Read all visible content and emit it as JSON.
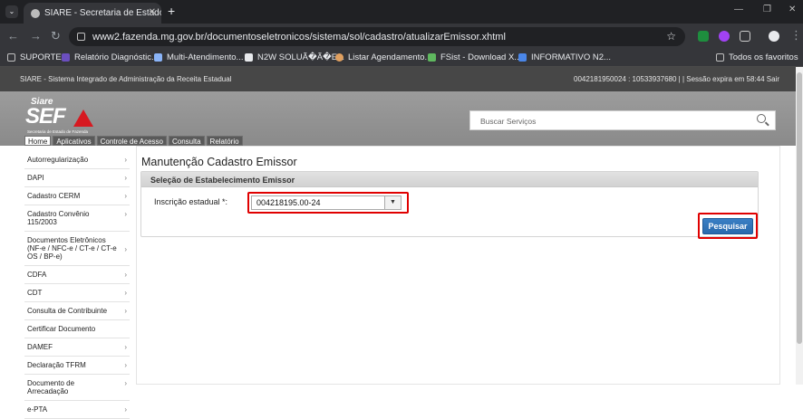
{
  "browser": {
    "tab_title": "SIARE - Secretaria de Estado de...",
    "url": "www2.fazenda.mg.gov.br/documentoseletronicos/sistema/sol/cadastro/atualizarEmissor.xhtml",
    "bookmarks": [
      {
        "label": "SUPORTE",
        "color": "#c0c0c0"
      },
      {
        "label": "Relatório Diagnóstic...",
        "color": "#6b4fbf"
      },
      {
        "label": "Multi-Atendimento...",
        "color": "#8ab4f8"
      },
      {
        "label": "N2W SOLUÃ�Ã�E...",
        "color": "#e8eaed"
      },
      {
        "label": "Listar Agendamento...",
        "color": "#e0a060"
      },
      {
        "label": "FSist - Download X...",
        "color": "#5fb85f"
      },
      {
        "label": "INFORMATIVO N2...",
        "color": "#4a86e8"
      }
    ],
    "all_bookmarks": "Todos os favoritos",
    "icons": [
      "tab-menu-icon",
      "back-icon",
      "forward-icon",
      "reload-icon",
      "site-info-icon",
      "star-icon",
      "extension-icon",
      "profile-icon",
      "menu-icon",
      "folder-icon"
    ]
  },
  "header": {
    "system_name": "SIARE - Sistema Integrado de Administração da Receita Estadual",
    "session_info": "0042181950024 : 10533937680 | | Sessão expira em 58:44 Sair",
    "logo": {
      "siare": "Siare",
      "sef": "SEF",
      "subtitle": "Secretaria de Estado de Fazenda"
    },
    "search_placeholder": "Buscar Serviços"
  },
  "main_nav": [
    "Home",
    "Aplicativos",
    "Controle de Acesso",
    "Consulta",
    "Relatório"
  ],
  "sidebar": [
    "Autorregularização",
    "DAPI",
    "Cadastro CERM",
    "Cadastro Convênio 115/2003",
    "Documentos Eletrônicos (NF-e / NFC-e / CT-e / CT-e OS / BP-e)",
    "CDFA",
    "CDT",
    "Consulta de Contribuinte",
    "Certificar Documento",
    "DAMEF",
    "Declaração TFRM",
    "Documento de Arrecadação",
    "e-PTA"
  ],
  "content": {
    "page_title": "Manutenção Cadastro Emissor",
    "panel_title": "Seleção de Estabelecimento Emissor",
    "ie_label": "Inscrição estadual *:",
    "ie_value": "004218195.00-24",
    "search_button": "Pesquisar"
  },
  "colors": {
    "highlight": "#e00000",
    "button": "#2f74b9",
    "logo_red": "#d71920"
  }
}
